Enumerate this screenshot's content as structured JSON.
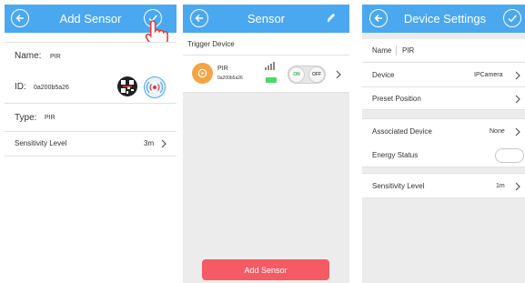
{
  "screen1": {
    "title": "Add Sensor",
    "name_label": "Name:",
    "name_value": "PIR",
    "id_label": "ID:",
    "id_value": "0a200b5a26",
    "type_label": "Type:",
    "type_value": "PIR",
    "sensitivity_label": "Sensitivity Level",
    "sensitivity_value": "3m"
  },
  "screen2": {
    "title": "Sensor",
    "section_label": "Trigger Device",
    "device_name": "PIR",
    "device_id": "0a200b5a26",
    "toggle_on": "ON",
    "toggle_off": "OFF",
    "add_button": "Add Sensor"
  },
  "screen3": {
    "title": "Device Settings",
    "name_label": "Name",
    "name_value": "PIR",
    "device_label": "Device",
    "device_value": "IPCamera",
    "preset_label": "Preset Position",
    "associated_label": "Associated Device",
    "associated_value": "None",
    "energy_label": "Energy Status",
    "sensitivity_label": "Sensitivity Level",
    "sensitivity_value": "1m"
  },
  "colors": {
    "header_blue": "#4aa8f0",
    "add_button_red": "#f45b65",
    "battery_green": "#4cd964",
    "sensor_icon_orange": "#f5a443"
  }
}
